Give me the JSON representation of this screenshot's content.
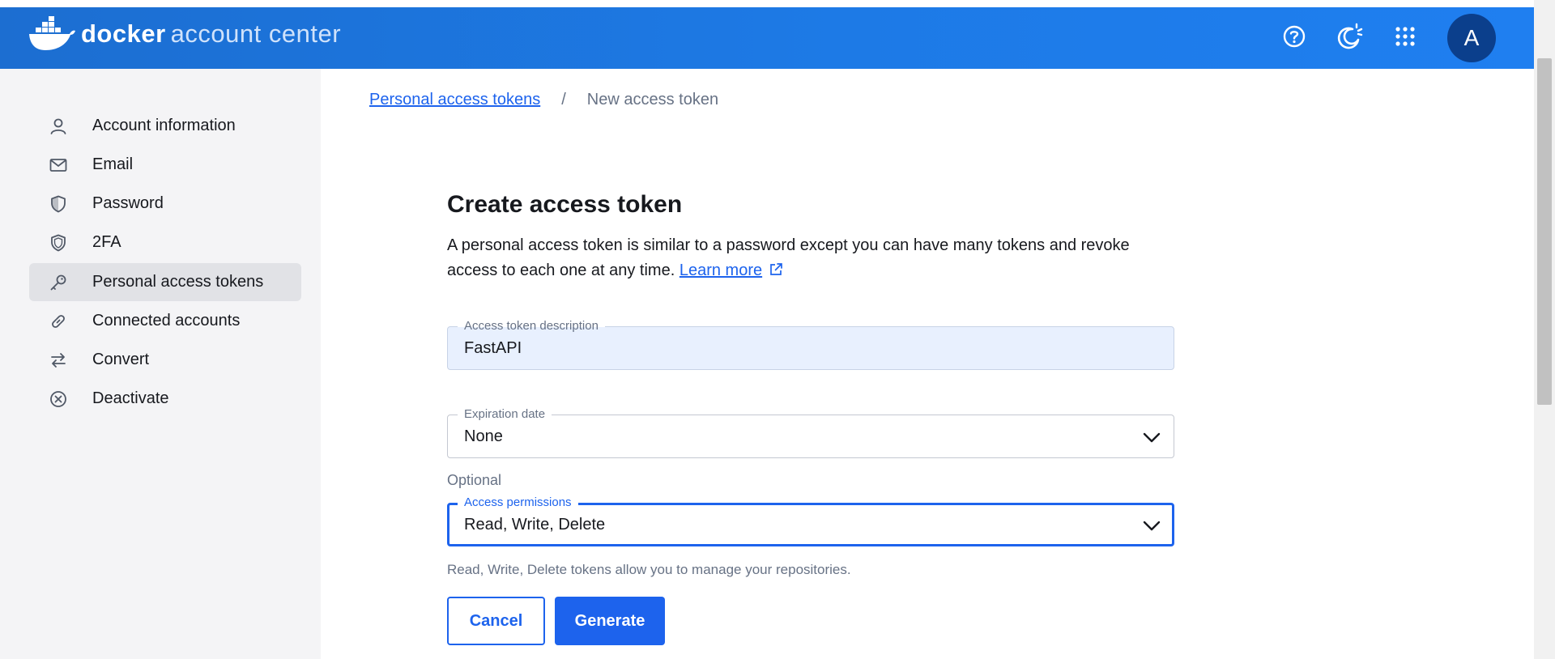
{
  "header": {
    "brand": "docker",
    "product": "account center",
    "avatar_initial": "A",
    "icons": [
      "help-icon",
      "theme-toggle-icon",
      "apps-grid-icon"
    ]
  },
  "sidebar": {
    "items": [
      {
        "label": "Account information",
        "icon": "user-icon",
        "active": false
      },
      {
        "label": "Email",
        "icon": "mail-icon",
        "active": false
      },
      {
        "label": "Password",
        "icon": "shield-icon",
        "active": false
      },
      {
        "label": "2FA",
        "icon": "shield-icon",
        "active": false
      },
      {
        "label": "Personal access tokens",
        "icon": "key-icon",
        "active": true
      },
      {
        "label": "Connected accounts",
        "icon": "link-icon",
        "active": false
      },
      {
        "label": "Convert",
        "icon": "swap-icon",
        "active": false
      },
      {
        "label": "Deactivate",
        "icon": "circle-x-icon",
        "active": false
      }
    ]
  },
  "breadcrumb": {
    "parent": "Personal access tokens",
    "separator": "/",
    "current": "New access token"
  },
  "form": {
    "title": "Create access token",
    "description": "A personal access token is similar to a password except you can have many tokens and revoke access to each one at any time.",
    "learn_more": "Learn more",
    "description_field": {
      "label": "Access token description",
      "value": "FastAPI"
    },
    "expiration": {
      "label": "Expiration date",
      "value": "None",
      "helper": "Optional"
    },
    "permissions": {
      "label": "Access permissions",
      "value": "Read, Write, Delete",
      "helper": "Read, Write, Delete tokens allow you to manage your repositories."
    },
    "cancel_label": "Cancel",
    "generate_label": "Generate"
  },
  "colors": {
    "header_blue": "#1d7ae6",
    "primary": "#1d63ed",
    "avatar_bg": "#0b3f8c",
    "sidebar_bg": "#f4f4f6",
    "active_item_bg": "#e1e2e6"
  }
}
